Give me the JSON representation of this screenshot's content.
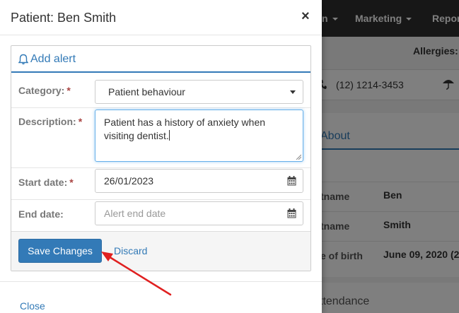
{
  "background": {
    "nav": [
      {
        "label": "n",
        "caret": true
      },
      {
        "label": "Marketing",
        "caret": true
      },
      {
        "label": "Repor",
        "caret": false
      }
    ],
    "allergies_label": "Allergies:",
    "phone": "(12) 1214-3453",
    "about_tab": "About",
    "rows": [
      {
        "label": "tname",
        "value": "Ben"
      },
      {
        "label": "tname",
        "value": "Smith"
      },
      {
        "label": "e of birth",
        "value": "June 09, 2020 (2"
      }
    ],
    "attendance": "ttendance"
  },
  "modal": {
    "title": "Patient: Ben Smith",
    "close_symbol": "×",
    "panel_title": "Add alert",
    "form": {
      "category": {
        "label": "Category:",
        "required": "*",
        "value": "Patient behaviour"
      },
      "description": {
        "label": "Description:",
        "required": "*",
        "value": "Patient has a history of anxiety when visiting dentist."
      },
      "start_date": {
        "label": "Start date:",
        "required": "*",
        "value": "26/01/2023"
      },
      "end_date": {
        "label": "End date:",
        "placeholder": "Alert end date"
      }
    },
    "save_label": "Save Changes",
    "discard_label": "Discard",
    "close_label": "Close"
  },
  "colors": {
    "primary": "#337ab7",
    "required": "#a94442",
    "annotation_arrow": "#e02020"
  },
  "icons": {
    "panel": "bell-icon",
    "dates": "calendar-icon",
    "phone": "phone-icon",
    "insurance": "umbrella-icon"
  }
}
